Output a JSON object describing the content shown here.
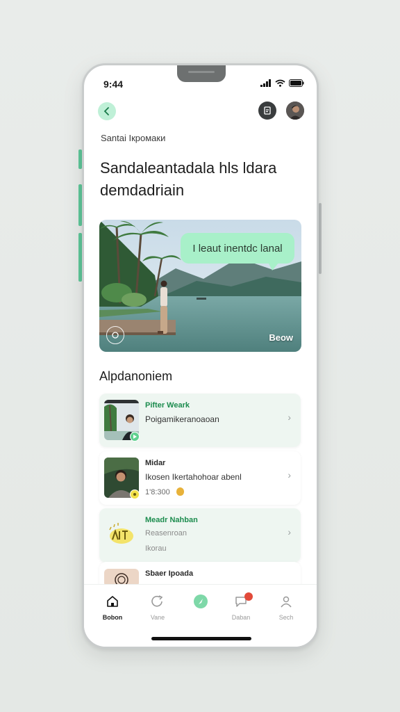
{
  "status": {
    "time": "9:44"
  },
  "header": {
    "subtitle": "Santai Ікромаки",
    "title": "Sandaleantadala hls ldara demdadriain"
  },
  "hero": {
    "bubble_text": "I leaut inentdc lanal",
    "caption": "Beow"
  },
  "section": {
    "title": "Alpdanoniem"
  },
  "list": [
    {
      "name": "Pifter Weark",
      "line1": "Poigamikeranoaoan",
      "line2": ""
    },
    {
      "name": "Midar",
      "line1": "Ikosen Ikertahohoar abenl",
      "line2": "1'8:300"
    },
    {
      "name": "Meadr Nahban",
      "line1": "Reasenroan",
      "line2": "Ikorau"
    },
    {
      "name": "Sbaer Ipoada",
      "line1": "",
      "line2": ""
    }
  ],
  "tabs": [
    {
      "label": "Bobon"
    },
    {
      "label": "Vane"
    },
    {
      "label": ""
    },
    {
      "label": "Daban"
    },
    {
      "label": "Sech"
    }
  ],
  "colors": {
    "accent": "#5fc79a",
    "bubble": "#a8f0c9",
    "name_green": "#1c8c4e"
  }
}
